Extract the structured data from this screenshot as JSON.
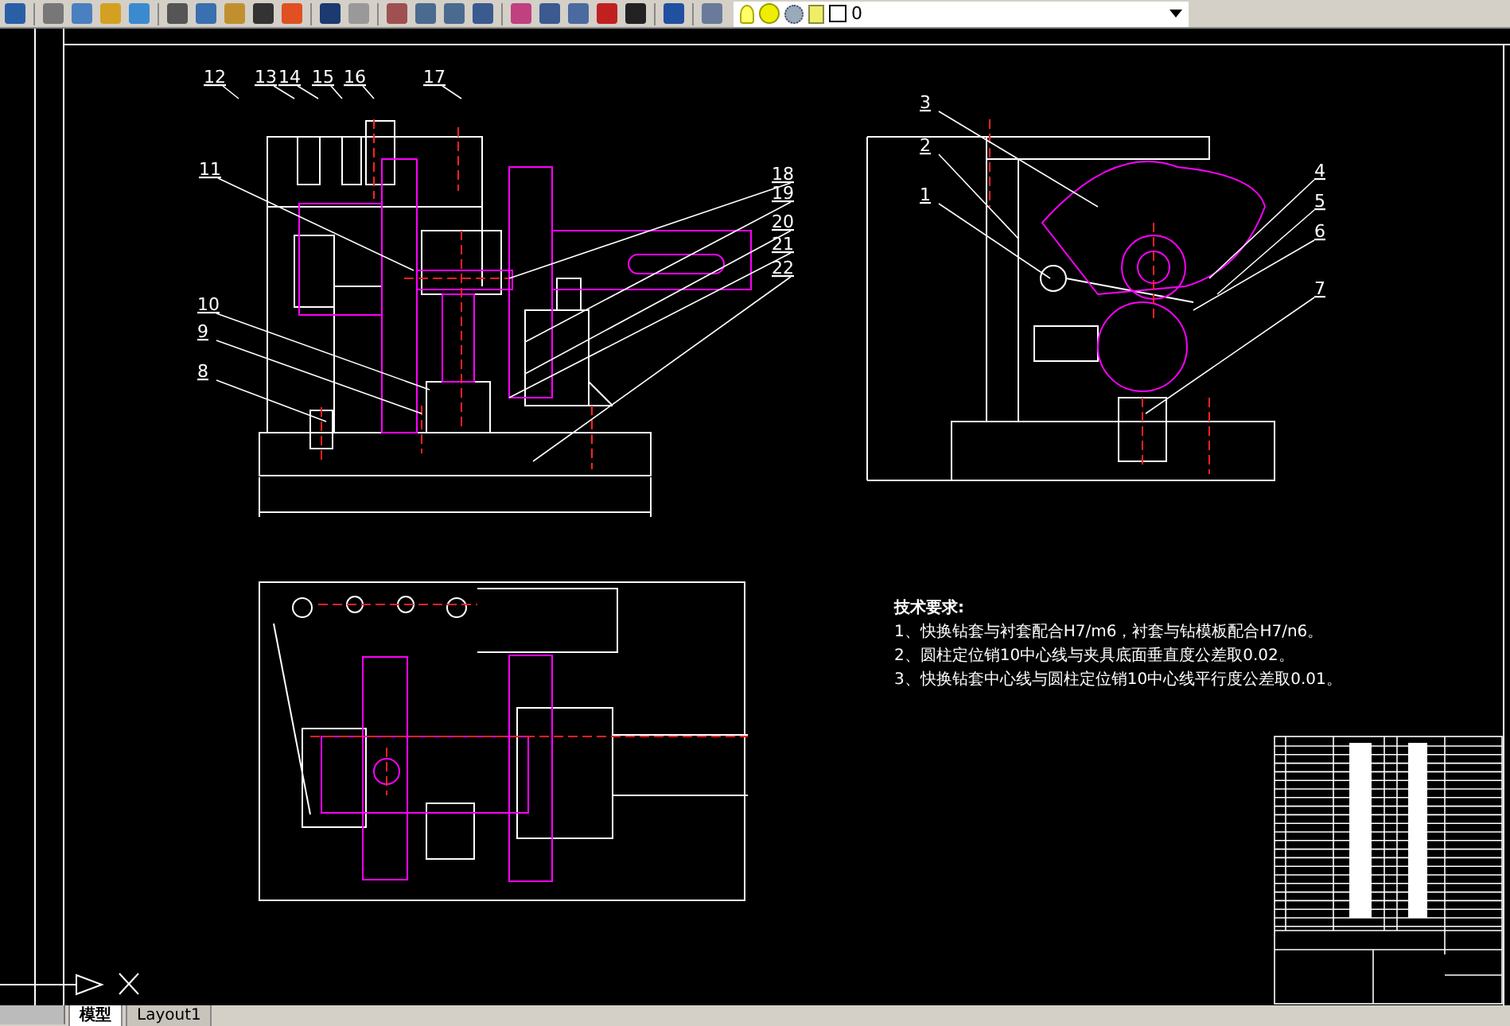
{
  "toolbar": {
    "layer": {
      "name": "0"
    }
  },
  "callouts": [
    "12",
    "13",
    "14",
    "15",
    "16",
    "17",
    "11",
    "18",
    "19",
    "20",
    "21",
    "22",
    "10",
    "9",
    "8",
    "3",
    "2",
    "1",
    "4",
    "5",
    "6",
    "7"
  ],
  "notes": {
    "title": "技术要求:",
    "items": [
      "1、快换钻套与衬套配合H7/m6，衬套与钻模板配合H7/n6。",
      "2、圆柱定位销10中心线与夹具底面垂直度公差取0.02。",
      "3、快换钻套中心线与圆柱定位销10中心线平行度公差取0.01。"
    ]
  },
  "layout_tabs": [
    {
      "label": "模型",
      "selected": true
    },
    {
      "label": "Layout1",
      "selected": false
    }
  ]
}
